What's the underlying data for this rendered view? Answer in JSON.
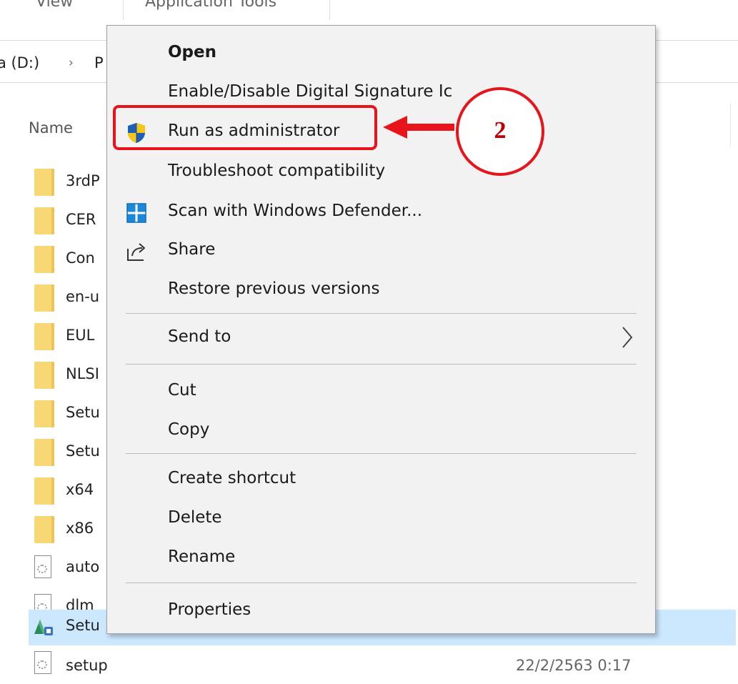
{
  "ribbon": {
    "tabs": [
      {
        "label": "View"
      },
      {
        "label": "Application Tools"
      }
    ]
  },
  "address": {
    "drive": "a (D:)",
    "chevron": "›",
    "next": "P"
  },
  "columns": {
    "name": "Name"
  },
  "files": [
    {
      "name": "3rdP",
      "type": "folder"
    },
    {
      "name": "CER",
      "type": "folder"
    },
    {
      "name": "Con",
      "type": "folder"
    },
    {
      "name": "en-u",
      "type": "folder"
    },
    {
      "name": "EUL",
      "type": "folder"
    },
    {
      "name": "NLSI",
      "type": "folder"
    },
    {
      "name": "Setu",
      "type": "folder"
    },
    {
      "name": "Setu",
      "type": "folder"
    },
    {
      "name": "x64",
      "type": "folder"
    },
    {
      "name": "x86",
      "type": "folder"
    },
    {
      "name": "auto",
      "type": "file"
    },
    {
      "name": "dlm",
      "type": "file"
    },
    {
      "name": "Setu",
      "type": "setup",
      "selected": true
    },
    {
      "name": "setup",
      "type": "file",
      "date": "22/2/2563 0:17"
    }
  ],
  "menu": {
    "items": [
      {
        "label": "Open",
        "bold": true
      },
      {
        "label": "Enable/Disable Digital Signature Ic"
      },
      {
        "label": "Run as administrator",
        "icon": "uac-shield-icon"
      },
      {
        "label": "Troubleshoot compatibility"
      },
      {
        "label": "Scan with Windows Defender...",
        "icon": "defender-icon"
      },
      {
        "label": "Share",
        "icon": "share-icon"
      },
      {
        "label": "Restore previous versions"
      },
      {
        "label": "Send to",
        "submenu": true
      },
      {
        "label": "Cut"
      },
      {
        "label": "Copy"
      },
      {
        "label": "Create shortcut"
      },
      {
        "label": "Delete"
      },
      {
        "label": "Rename"
      },
      {
        "label": "Properties"
      }
    ]
  },
  "annotation": {
    "step": "2",
    "color": "#e8141b"
  },
  "colors": {
    "menu_bg": "#f2f2f2",
    "selection": "#cce8ff",
    "folder": "#f8d775"
  }
}
